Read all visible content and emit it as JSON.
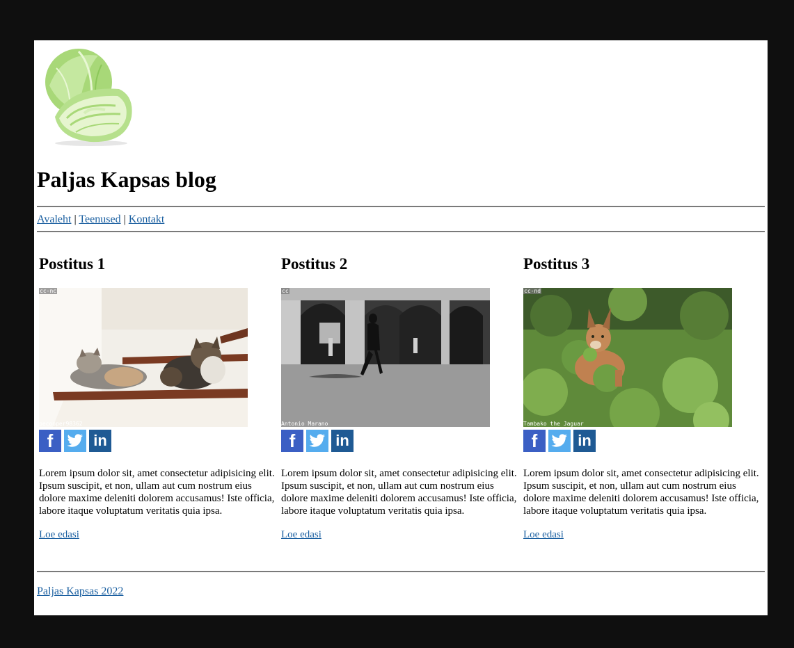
{
  "header": {
    "logo_icon": "cabbage-icon",
    "title": "Paljas Kapsas blog"
  },
  "nav": {
    "items": [
      "Avaleht",
      "Teenused",
      "Kontakt"
    ],
    "separator": "|"
  },
  "posts": [
    {
      "title": "Postitus 1",
      "image_license": "cc-nc",
      "image_credit": "pecooper98362",
      "text": "Lorem ipsum dolor sit, amet consectetur adipisicing elit. Ipsum suscipit, et non, ullam aut cum nostrum eius dolore maxime deleniti dolorem accusamus! Iste officia, labore itaque voluptatum veritatis quia ipsa.",
      "read_more": "Loe edasi"
    },
    {
      "title": "Postitus 2",
      "image_license": "cc",
      "image_credit": "Antonio Marano",
      "text": "Lorem ipsum dolor sit, amet consectetur adipisicing elit. Ipsum suscipit, et non, ullam aut cum nostrum eius dolore maxime deleniti dolorem accusamus! Iste officia, labore itaque voluptatum veritatis quia ipsa.",
      "read_more": "Loe edasi"
    },
    {
      "title": "Postitus 3",
      "image_license": "cc-nd",
      "image_credit": "Tambako the Jaguar",
      "text": "Lorem ipsum dolor sit, amet consectetur adipisicing elit. Ipsum suscipit, et non, ullam aut cum nostrum eius dolore maxime deleniti dolorem accusamus! Iste officia, labore itaque voluptatum veritatis quia ipsa.",
      "read_more": "Loe edasi"
    }
  ],
  "social": {
    "facebook_glyph": "f",
    "linkedin_glyph": "in",
    "icons": [
      "facebook-icon",
      "twitter-icon",
      "linkedin-icon"
    ]
  },
  "footer": {
    "link": "Paljas Kapsas 2022"
  },
  "colors": {
    "link": "#1a5fa0",
    "outer_background": "#0f0f0f",
    "page_background": "#ffffff",
    "facebook": "#3b5fc4",
    "twitter": "#55acee",
    "linkedin": "#1f5a94"
  }
}
